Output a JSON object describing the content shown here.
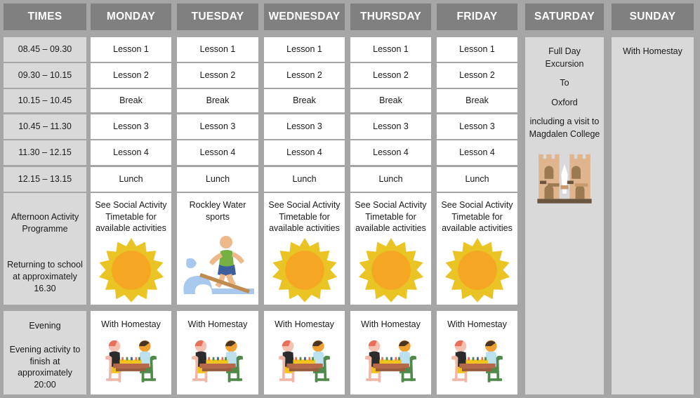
{
  "page": {
    "title": "Weekly Course Timetable",
    "background_color": "#a6a6a6",
    "header_color": "#808080",
    "times_column_color": "#d9d9d9",
    "day_cell_color": "#ffffff",
    "weekend_cell_color": "#d9d9d9"
  },
  "headers": [
    {
      "label": "TIMES"
    },
    {
      "label": "MONDAY"
    },
    {
      "label": "TUESDAY"
    },
    {
      "label": "WEDNESDAY"
    },
    {
      "label": "THURSDAY"
    },
    {
      "label": "FRIDAY"
    },
    {
      "label": "SATURDAY"
    },
    {
      "label": "SUNDAY"
    }
  ],
  "times": [
    {
      "label": "08.45 – 09.30"
    },
    {
      "label": "09.30 – 10.15"
    },
    {
      "label": "10.15 – 10.45"
    },
    {
      "label": "10.45 – 11.30"
    },
    {
      "label": "11.30 – 12.15"
    },
    {
      "label": "12.15 – 13.15"
    },
    {
      "label": "Afternoon Activity\nProgramme\n\n\nReturning to school\nat approximately\n16.30"
    },
    {
      "label": "Evening\n\nEvening activity to\nfinish at\napproximately\n20:00"
    }
  ],
  "rows": [
    {
      "time": "08.45 – 09.30",
      "cells": [
        {
          "text": "Lesson 1",
          "icon": ""
        },
        {
          "text": "Lesson 1",
          "icon": ""
        },
        {
          "text": "Lesson 1",
          "icon": ""
        },
        {
          "text": "Lesson 1",
          "icon": ""
        },
        {
          "text": "Lesson 1",
          "icon": ""
        }
      ]
    },
    {
      "time": "09.30 – 10.15",
      "cells": [
        {
          "text": "Lesson 2",
          "icon": ""
        },
        {
          "text": "Lesson 2",
          "icon": ""
        },
        {
          "text": "Lesson 2",
          "icon": ""
        },
        {
          "text": "Lesson 2",
          "icon": ""
        },
        {
          "text": "Lesson 2",
          "icon": ""
        }
      ]
    },
    {
      "time": "10.15 – 10.45",
      "cells": [
        {
          "text": "Break",
          "icon": ""
        },
        {
          "text": "Break",
          "icon": ""
        },
        {
          "text": "Break",
          "icon": ""
        },
        {
          "text": "Break",
          "icon": ""
        },
        {
          "text": "Break",
          "icon": ""
        }
      ]
    },
    {
      "time": "10.45 – 11.30",
      "cells": [
        {
          "text": "Lesson 3",
          "icon": ""
        },
        {
          "text": "Lesson 3",
          "icon": ""
        },
        {
          "text": "Lesson 3",
          "icon": ""
        },
        {
          "text": "Lesson 3",
          "icon": ""
        },
        {
          "text": "Lesson 3",
          "icon": ""
        }
      ]
    },
    {
      "time": "11.30 – 12.15",
      "cells": [
        {
          "text": "Lesson 4",
          "icon": ""
        },
        {
          "text": "Lesson 4",
          "icon": ""
        },
        {
          "text": "Lesson 4",
          "icon": ""
        },
        {
          "text": "Lesson 4",
          "icon": ""
        },
        {
          "text": "Lesson 4",
          "icon": ""
        }
      ]
    },
    {
      "time": "12.15 – 13.15",
      "cells": [
        {
          "text": "Lunch",
          "icon": ""
        },
        {
          "text": "Lunch",
          "icon": ""
        },
        {
          "text": "Lunch",
          "icon": ""
        },
        {
          "text": "Lunch",
          "icon": ""
        },
        {
          "text": "Lunch",
          "icon": ""
        }
      ]
    },
    {
      "time": "Afternoon Activity Programme",
      "cells": [
        {
          "text": "See Social Activity\nTimetable for\navailable activities",
          "icon": "sun-icon"
        },
        {
          "text": "Rockley Water\nsports",
          "icon": "surfer-icon"
        },
        {
          "text": "See Social Activity\nTimetable for\navailable activities",
          "icon": "sun-icon"
        },
        {
          "text": "See Social Activity\nTimetable for\navailable activities",
          "icon": "sun-icon"
        },
        {
          "text": "See Social Activity\nTimetable for\navailable activities",
          "icon": "sun-icon"
        }
      ]
    },
    {
      "time": "Evening",
      "cells": [
        {
          "text": "With Homestay",
          "icon": "homestay-dining-icon"
        },
        {
          "text": "With Homestay",
          "icon": "homestay-dining-icon"
        },
        {
          "text": "With Homestay",
          "icon": "homestay-dining-icon"
        },
        {
          "text": "With Homestay",
          "icon": "homestay-dining-icon"
        },
        {
          "text": "With Homestay",
          "icon": "homestay-dining-icon"
        }
      ]
    }
  ],
  "saturday": {
    "line1": "Full Day\nExcursion",
    "line2": "To",
    "line3": "Oxford",
    "line4": "including a visit to\nMagdalen College",
    "icon": "castle-icon"
  },
  "sunday": {
    "text": "With Homestay"
  },
  "colors": {
    "sun_outer": "#eac424",
    "sun_inner": "#f5a623",
    "water_blue": "#a8c9ed",
    "skin": "#edb98a",
    "shirt_green": "#76b043",
    "shorts_blue": "#3c5f9e",
    "board_brown": "#c08b4f",
    "castle_stone": "#e0b48c",
    "castle_dark": "#9b7a52",
    "castle_base": "#6b5541",
    "table_brown": "#b5684a",
    "chair_pink": "#f0b6a8",
    "chair_green": "#4f8a4a",
    "hair_black": "#2b2b2b",
    "hair_orange": "#f0a030"
  }
}
